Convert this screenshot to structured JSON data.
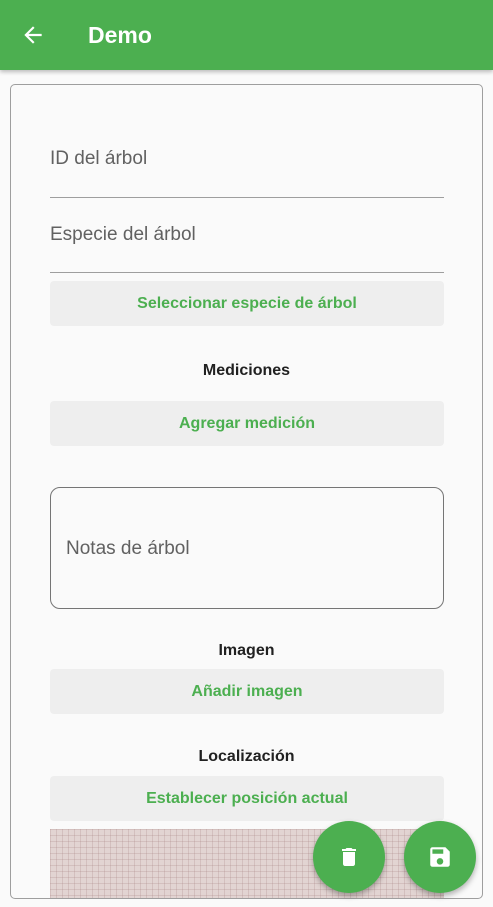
{
  "appbar": {
    "title": "Demo",
    "back_icon": "arrow-back-icon",
    "color": "#4caf50"
  },
  "form": {
    "tree_id": {
      "label": "ID del árbol",
      "value": ""
    },
    "tree_species": {
      "label": "Especie del árbol",
      "value": ""
    },
    "select_species_button": "Seleccionar especie de árbol",
    "measurements": {
      "title": "Mediciones",
      "add_button": "Agregar medición"
    },
    "notes": {
      "label": "Notas de árbol",
      "value": ""
    },
    "image": {
      "title": "Imagen",
      "add_button": "Añadir imagen"
    },
    "location": {
      "title": "Localización",
      "set_position_button": "Establecer posición actual"
    }
  },
  "fabs": {
    "delete_icon": "trash-icon",
    "save_icon": "save-icon"
  },
  "colors": {
    "accent": "#4caf50",
    "button_bg": "#eeeeee",
    "text_secondary": "#616161"
  }
}
